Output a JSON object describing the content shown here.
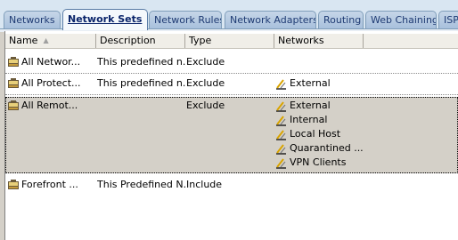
{
  "tabs": [
    {
      "label": "Networks"
    },
    {
      "label": "Network Sets"
    },
    {
      "label": "Network Rules"
    },
    {
      "label": "Network Adapters"
    },
    {
      "label": "Routing"
    },
    {
      "label": "Web Chaining"
    },
    {
      "label": "ISP"
    }
  ],
  "active_tab": "Network Sets",
  "columns": {
    "name": "Name",
    "description": "Description",
    "type": "Type",
    "networks": "Networks"
  },
  "sort": {
    "column": "Name",
    "direction": "ascending"
  },
  "rows": [
    {
      "name": "All Networ...",
      "description": "This predefined n...",
      "type": "Exclude",
      "networks": []
    },
    {
      "name": "All Protect...",
      "description": "This predefined n...",
      "type": "Exclude",
      "networks": [
        "External"
      ]
    },
    {
      "name": "All Remot...",
      "description": "",
      "type": "Exclude",
      "networks": [
        "External",
        "Internal",
        "Local Host",
        "Quarantined ...",
        "VPN Clients"
      ],
      "selected": true,
      "expanded": true
    },
    {
      "name": "Forefront ...",
      "description": "This Predefined N...",
      "type": "Include",
      "networks": []
    }
  ],
  "icons": {
    "network_set": "network-set-icon",
    "network": "network-icon"
  },
  "colors": {
    "selection": "#d4d0c8",
    "tab_active_text": "#0a246a",
    "tab_text": "#1f3b73"
  }
}
